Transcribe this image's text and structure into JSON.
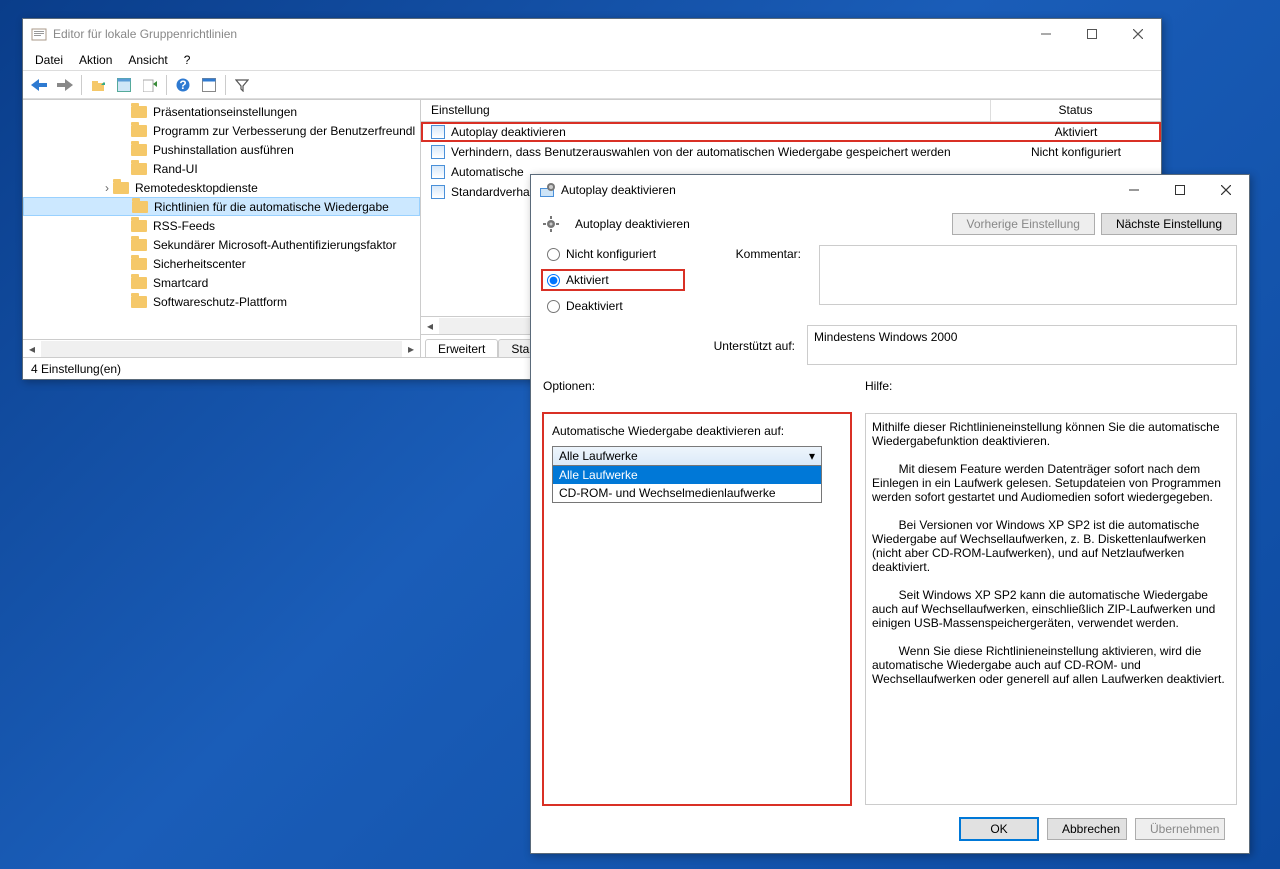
{
  "gp_window": {
    "title": "Editor für lokale Gruppenrichtlinien",
    "menu": {
      "file": "Datei",
      "action": "Aktion",
      "view": "Ansicht",
      "help": "?"
    },
    "tree": [
      {
        "label": "Präsentationseinstellungen"
      },
      {
        "label": "Programm zur Verbesserung der Benutzerfreundl"
      },
      {
        "label": "Pushinstallation ausführen"
      },
      {
        "label": "Rand-UI"
      },
      {
        "label": "Remotedesktopdienste",
        "expandable": true
      },
      {
        "label": "Richtlinien für die automatische Wiedergabe",
        "selected": true
      },
      {
        "label": "RSS-Feeds"
      },
      {
        "label": "Sekundärer Microsoft-Authentifizierungsfaktor"
      },
      {
        "label": "Sicherheitscenter"
      },
      {
        "label": "Smartcard"
      },
      {
        "label": "Softwareschutz-Plattform"
      }
    ],
    "list": {
      "columns": {
        "setting": "Einstellung",
        "status": "Status"
      },
      "rows": [
        {
          "setting": "Autoplay deaktivieren",
          "status": "Aktiviert",
          "highlight": true
        },
        {
          "setting": "Verhindern, dass Benutzerauswahlen von der automatischen Wiedergabe gespeichert werden",
          "status": "Nicht konfiguriert"
        },
        {
          "setting": "Automatische",
          "status": ""
        },
        {
          "setting": "Standardverha",
          "status": ""
        }
      ]
    },
    "tabs": {
      "extended": "Erweitert",
      "standard": "Standard"
    },
    "status": "4 Einstellung(en)"
  },
  "dialog": {
    "title": "Autoplay deaktivieren",
    "heading": "Autoplay deaktivieren",
    "prev_button": "Vorherige Einstellung",
    "next_button": "Nächste Einstellung",
    "radios": {
      "not_configured": "Nicht konfiguriert",
      "enabled": "Aktiviert",
      "disabled": "Deaktiviert"
    },
    "comment_label": "Kommentar:",
    "supported_label": "Unterstützt auf:",
    "supported_value": "Mindestens Windows 2000",
    "options_label": "Optionen:",
    "help_label": "Hilfe:",
    "options": {
      "prompt": "Automatische Wiedergabe deaktivieren auf:",
      "selected": "Alle Laufwerke",
      "items": [
        "Alle Laufwerke",
        "CD-ROM- und Wechselmedienlaufwerke"
      ]
    },
    "help_text": "Mithilfe dieser Richtlinieneinstellung können Sie die automatische Wiedergabefunktion deaktivieren.\n\n        Mit diesem Feature werden Datenträger sofort nach dem Einlegen in ein Laufwerk gelesen. Setupdateien von Programmen werden sofort gestartet und Audiomedien sofort wiedergegeben.\n\n        Bei Versionen vor Windows XP SP2 ist die automatische Wiedergabe auf Wechsellaufwerken, z. B. Diskettenlaufwerken (nicht aber CD-ROM-Laufwerken), und auf Netzlaufwerken deaktiviert.\n\n        Seit Windows XP SP2 kann die automatische Wiedergabe auch auf Wechsellaufwerken, einschließlich ZIP-Laufwerken und einigen USB-Massenspeichergeräten, verwendet werden.\n\n        Wenn Sie diese Richtlinieneinstellung aktivieren, wird die automatische Wiedergabe auch auf CD-ROM- und Wechsellaufwerken oder generell auf allen Laufwerken deaktiviert.",
    "ok": "OK",
    "cancel": "Abbrechen",
    "apply": "Übernehmen"
  }
}
